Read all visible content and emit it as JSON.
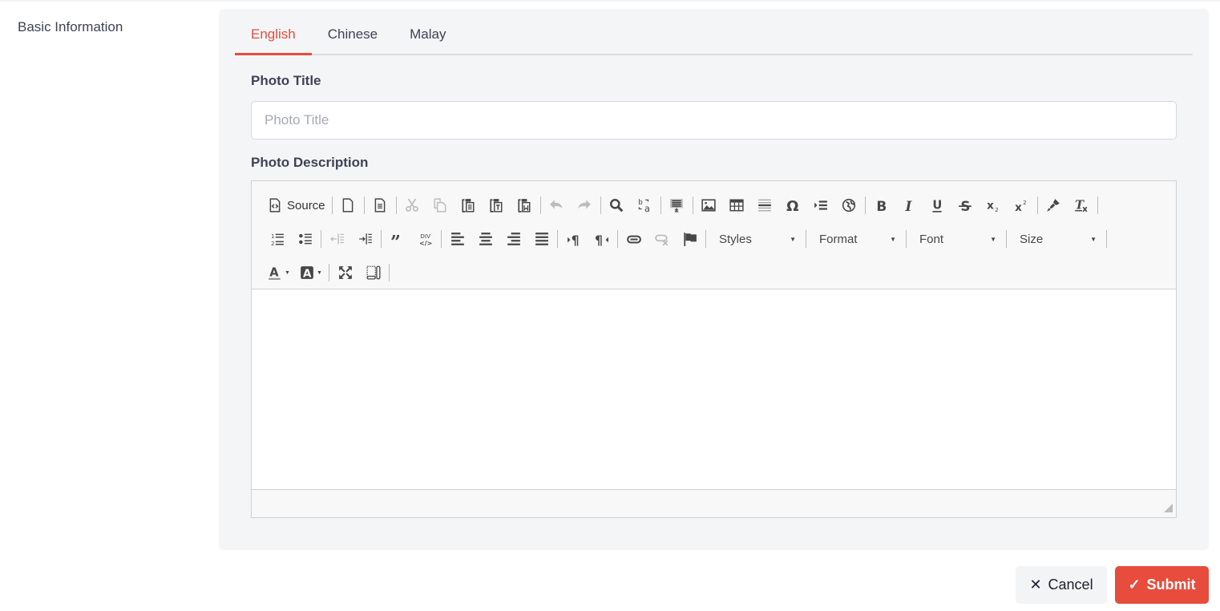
{
  "section": {
    "label": "Basic Information"
  },
  "tabs": [
    {
      "label": "English",
      "active": true
    },
    {
      "label": "Chinese",
      "active": false
    },
    {
      "label": "Malay",
      "active": false
    }
  ],
  "form": {
    "photo_title_label": "Photo Title",
    "photo_title_placeholder": "Photo Title",
    "photo_title_value": "",
    "photo_description_label": "Photo Description"
  },
  "editor": {
    "source_label": "Source",
    "combos": {
      "styles": "Styles",
      "format": "Format",
      "font": "Font",
      "size": "Size"
    },
    "toolbar_icons": {
      "row1": [
        "source",
        "new-page",
        "preview",
        "cut",
        "copy",
        "paste",
        "paste-text",
        "paste-word",
        "undo",
        "redo",
        "find",
        "replace",
        "select-all",
        "image",
        "table",
        "horizontal-rule",
        "special-char",
        "page-break",
        "iframe",
        "bold",
        "italic",
        "underline",
        "strike",
        "subscript",
        "superscript",
        "copy-format",
        "remove-format"
      ],
      "row2": [
        "numbered-list",
        "bulleted-list",
        "outdent",
        "indent",
        "blockquote",
        "create-div",
        "align-left",
        "align-center",
        "align-right",
        "justify",
        "ltr",
        "rtl",
        "link",
        "unlink",
        "anchor",
        "styles",
        "format",
        "font",
        "size"
      ],
      "row3": [
        "text-color",
        "bg-color",
        "maximize",
        "show-blocks"
      ]
    },
    "content": ""
  },
  "actions": {
    "cancel_label": "Cancel",
    "submit_label": "Submit"
  },
  "colors": {
    "accent": "#e74c3c",
    "panel_bg": "#f4f5f7",
    "text": "#3f4254"
  }
}
